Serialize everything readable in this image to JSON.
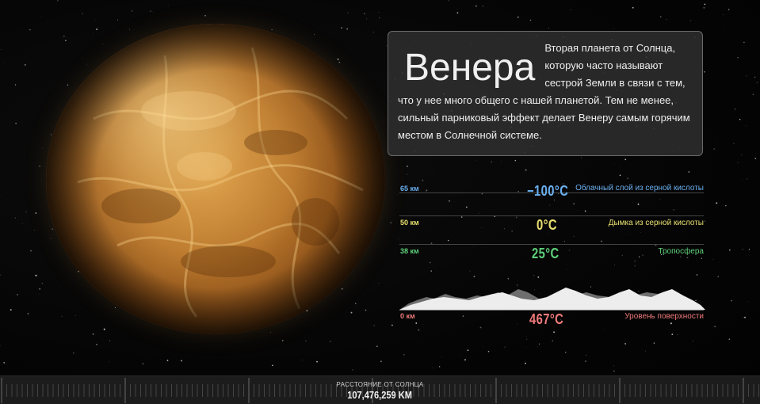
{
  "planet": {
    "name": "Венера",
    "description": "Вторая планета от Солнца, которую часто называют сестрой Земли в связи с тем, что у нее много общего с нашей планетой. Тем не менее, сильный парниковый эффект делает Венеру самым горячим местом в Солнечной системе."
  },
  "layers": [
    {
      "km": "65 км",
      "temp": "−100°C",
      "label": "Облачный слой из серной кислоты",
      "color": "#6ab0f0"
    },
    {
      "km": "50 км",
      "temp": "0°C",
      "label": "Дымка из серной кислоты",
      "color": "#e8e070"
    },
    {
      "km": "38 км",
      "temp": "25°C",
      "label": "Тропосфера",
      "color": "#5ed07a"
    },
    {
      "km": "0 км",
      "temp": "467°C",
      "label": "Уровень поверхности",
      "color": "#f07a7a"
    }
  ],
  "distance": {
    "label": "РАССТОЯНИЕ ОТ СОЛНЦА",
    "value": "107,476,259 KM"
  }
}
